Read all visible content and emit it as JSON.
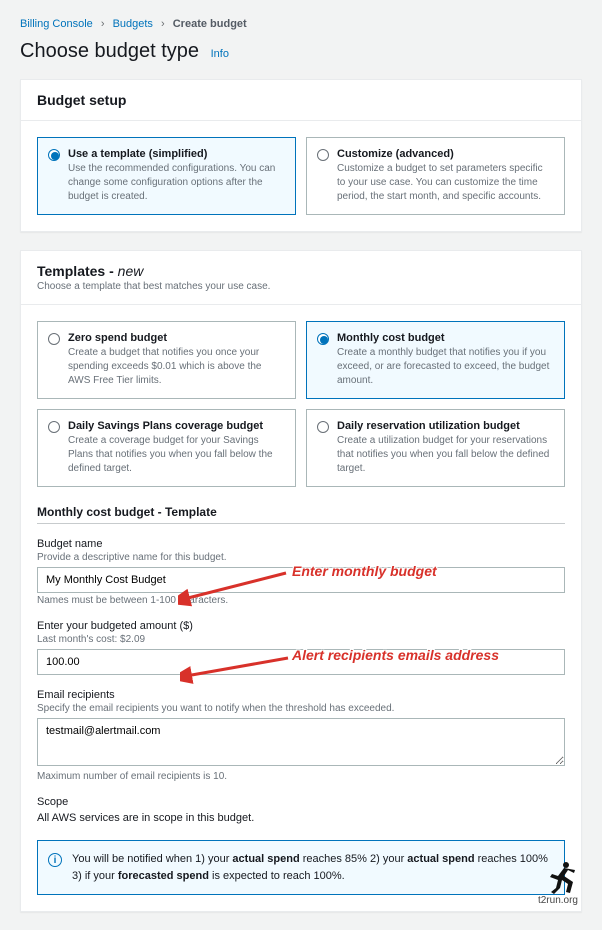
{
  "breadcrumb": {
    "root": "Billing Console",
    "mid": "Budgets",
    "current": "Create budget"
  },
  "page_title": "Choose budget type",
  "info_link": "Info",
  "budget_setup": {
    "header": "Budget setup",
    "options": [
      {
        "title": "Use a template (simplified)",
        "desc": "Use the recommended configurations. You can change some configuration options after the budget is created."
      },
      {
        "title": "Customize (advanced)",
        "desc": "Customize a budget to set parameters specific to your use case. You can customize the time period, the start month, and specific accounts."
      }
    ],
    "selected_index": 0
  },
  "templates": {
    "header": "Templates - ",
    "new": "new",
    "desc": "Choose a template that best matches your use case.",
    "options": [
      {
        "title": "Zero spend budget",
        "desc": "Create a budget that notifies you once your spending exceeds $0.01 which is above the AWS Free Tier limits."
      },
      {
        "title": "Monthly cost budget",
        "desc": "Create a monthly budget that notifies you if you exceed, or are forecasted to exceed, the budget amount."
      },
      {
        "title": "Daily Savings Plans coverage budget",
        "desc": "Create a coverage budget for your Savings Plans that notifies you when you fall below the defined target."
      },
      {
        "title": "Daily reservation utilization budget",
        "desc": "Create a utilization budget for your reservations that notifies you when you fall below the defined target."
      }
    ],
    "selected_index": 1
  },
  "form": {
    "section_title": "Monthly cost budget - Template",
    "budget_name": {
      "label": "Budget name",
      "hint": "Provide a descriptive name for this budget.",
      "value": "My Monthly Cost Budget",
      "below": "Names must be between 1-100 characters."
    },
    "amount": {
      "label": "Enter your budgeted amount ($)",
      "hint": "Last month's cost: $2.09",
      "value": "100.00"
    },
    "recipients": {
      "label": "Email recipients",
      "hint": "Specify the email recipients you want to notify when the threshold has exceeded.",
      "value": "testmail@alertmail.com",
      "below": "Maximum number of email recipients is 10."
    },
    "scope": {
      "label": "Scope",
      "text": "All AWS services are in scope in this budget."
    },
    "alert_prefix": "You will be notified when 1) your ",
    "alert_b1": "actual spend",
    "alert_mid1": " reaches 85% 2) your ",
    "alert_b2": "actual spend",
    "alert_mid2": " reaches 100% 3) if your ",
    "alert_b3": "forecasted spend",
    "alert_suffix": " is expected to reach 100%."
  },
  "annotations": {
    "budget": "Enter monthly budget",
    "emails": "Alert recipients emails address"
  },
  "watermark": "t2run.org"
}
